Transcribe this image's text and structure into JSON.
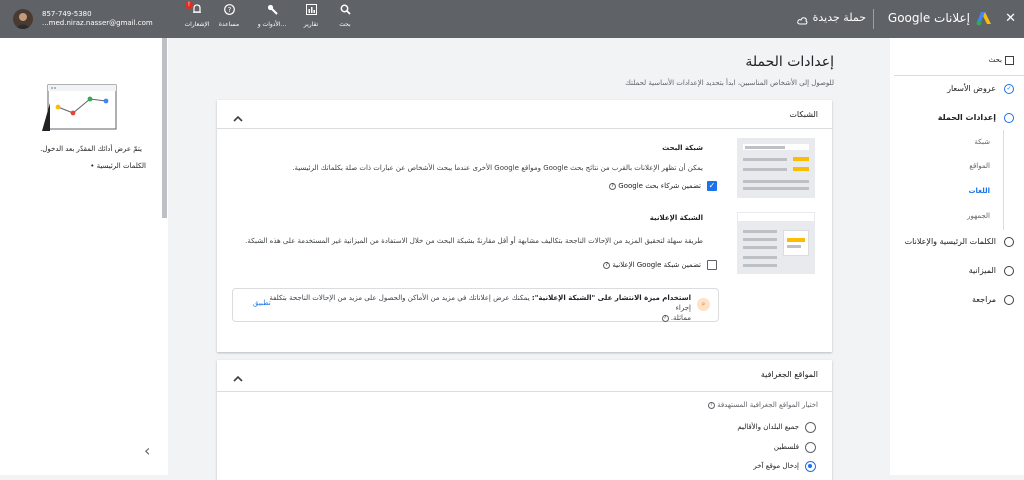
{
  "topbar": {
    "close_icon": "✕",
    "product": "إعلانات Google",
    "campaign": "حملة جديدة",
    "tools": [
      {
        "label": "بحث",
        "icon": "search-icon"
      },
      {
        "label": "تقارير",
        "icon": "reports-icon"
      },
      {
        "label": "الأدوات و...",
        "icon": "tools-icon"
      },
      {
        "label": "مساعدة",
        "icon": "help-icon"
      },
      {
        "label": "الإشعارات",
        "icon": "bell-icon",
        "badge": "!"
      }
    ],
    "phone": "857-749-5380",
    "email": "...med.niraz.nasser@gmail.com"
  },
  "nav": {
    "search_label": "بحث",
    "items": [
      {
        "label": "عروض الأسعار",
        "state": "done"
      },
      {
        "label": "إعدادات الحملة",
        "state": "current"
      },
      {
        "label": "الكلمات الرئيسية والإعلانات",
        "state": "todo"
      },
      {
        "label": "الميزانية",
        "state": "todo"
      },
      {
        "label": "مراجعة",
        "state": "todo"
      }
    ],
    "subitems": [
      "شبكة",
      "المواقع",
      "اللغات",
      "الجمهور"
    ]
  },
  "main": {
    "title": "إعدادات الحملة",
    "subtitle": "للوصول إلى الأشخاص المناسبين، ابدأ بتحديد الإعدادات الأساسية لحملتك",
    "networks": {
      "header": "الشبكات",
      "search_title": "شبكة البحث",
      "search_desc": "يمكن أن تظهر الإعلانات بالقرب من نتائج بحث Google ومواقع Google الأخرى عندما يبحث الأشخاص عن عبارات ذات صلة بكلماتك الرئيسية.",
      "search_partners": "تضمين شركاء بحث Google",
      "display_title": "الشبكة الإعلانية",
      "display_desc": "طريقة سهلة لتحقيق المزيد من الإحالات الناجحة بتكاليف مشابهة أو أقل مقارنةً بشبكة البحث من خلال الاستفادة من الميزانية غير المستخدمة على هذه الشبكة.",
      "display_include": "تضمين شبكة Google الإعلانية",
      "tip_bold": "استخدام ميزة الانتشار على \"الشبكة الإعلانية\":",
      "tip_text": " يمكنك عرض إعلاناتك في مزيد من الأماكن والحصول على مزيد من الإحالات الناجحة بتكلفة إجراء",
      "tip_text2": "مماثلة.",
      "apply": "تطبيق"
    },
    "geo": {
      "header": "المواقع الجغرافية",
      "question": "اختيار المواقع الجغرافية المستهدفة",
      "options": [
        "جميع البلدان والأقاليم",
        "فلسطين",
        "إدخال موقع آخر"
      ],
      "selected_index": 2
    }
  },
  "leftpane": {
    "hint": "يتمّ عرض أدائك المقدّر بعد الدخول.",
    "bullet": "الكلمات الرئيسية",
    "collapse_icon": "‹"
  },
  "colors": {
    "accent": "#1a73e8",
    "topbar": "#5f6368",
    "yellow": "#fbbc04",
    "red": "#ea4335",
    "green": "#34a853",
    "blue": "#4285f4"
  }
}
